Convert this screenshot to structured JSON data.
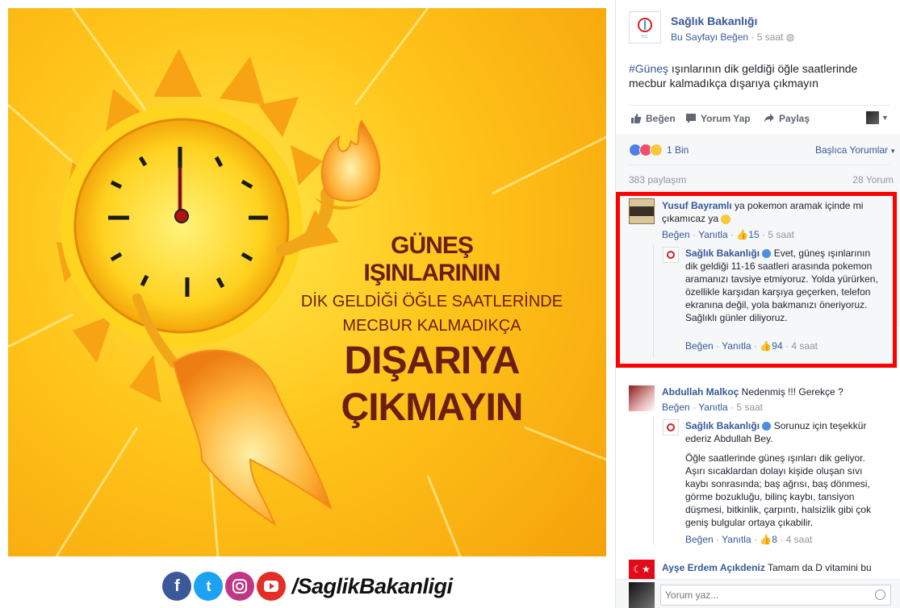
{
  "poster": {
    "line1": "GÜNEŞ",
    "line2": "IŞINLARININ",
    "line3": "DİK GELDİĞİ ÖĞLE SAATLERİNDE",
    "line4": "MECBUR KALMADIKÇA",
    "line5": "DIŞARIYA",
    "line6": "ÇIKMAYIN",
    "handle": "/SaglikBakanligi"
  },
  "page": {
    "name": "Sağlık Bakanlığı",
    "like_page": "Bu Sayfayı Beğen",
    "time": "5 saat",
    "hashtag": "#Güneş",
    "post_text": " ışınlarının dik geldiği öğle saatlerinde mecbur kalmadıkça dışarıya çıkmayın"
  },
  "actions": {
    "like": "Beğen",
    "comment": "Yorum Yap",
    "share": "Paylaş"
  },
  "stats": {
    "reactions": "1 Bin",
    "sort": "Başlıca Yorumlar",
    "shares": "383 paylaşım",
    "comments": "28 Yorum"
  },
  "comments": [
    {
      "name": "Yusuf Bayramlı",
      "text": " ya pokemon aramak içinde mi çıkamıcaz ya",
      "like": "Beğen",
      "reply": "Yanıtla",
      "likes": "15",
      "time": "5 saat",
      "reply_comment": {
        "name": "Sağlık Bakanlığı",
        "text": "Evet, güneş ışınlarının dik geldiği 11-16 saatleri arasında pokemon aramanızı tavsiye etmiyoruz. Yolda yürürken, özellikle karşıdan karşıya geçerken, telefon ekranına değil, yola bakmanızı öneriyoruz. Sağlıklı günler diliyoruz.",
        "like": "Beğen",
        "reply": "Yanıtla",
        "likes": "94",
        "time": "4 saat"
      }
    },
    {
      "name": "Abdullah Malkoç",
      "text": " Nedenmiş !!! Gerekçe ?",
      "like": "Beğen",
      "reply": "Yanıtla",
      "time": "5 saat",
      "reply_comment": {
        "name": "Sağlık Bakanlığı",
        "text1": "Sorunuz için teşekkür ederiz Abdullah Bey.",
        "text2": "Öğle saatlerinde güneş ışınları dik geliyor. Aşırı sıcaklardan dolayı kişide oluşan sıvı kaybı sonrasında; baş ağrısı, baş dönmesi, görme bozukluğu, bilinç kaybı, tansiyon düşmesi, bitkinlik, çarpıntı, halsizlik gibi çok geniş bulgular ortaya çıkabilir.",
        "like": "Beğen",
        "reply": "Yanıtla",
        "likes": "8",
        "time": "4 saat"
      }
    },
    {
      "name": "Ayşe Erdem Açıkdeniz",
      "text": " Tamam da D vitamini bu"
    }
  ],
  "composer": {
    "placeholder": "Yorum yaz..."
  },
  "colors": {
    "highlight": "#ff0000",
    "link": "#365899",
    "poster_text": "#6b1e14"
  }
}
